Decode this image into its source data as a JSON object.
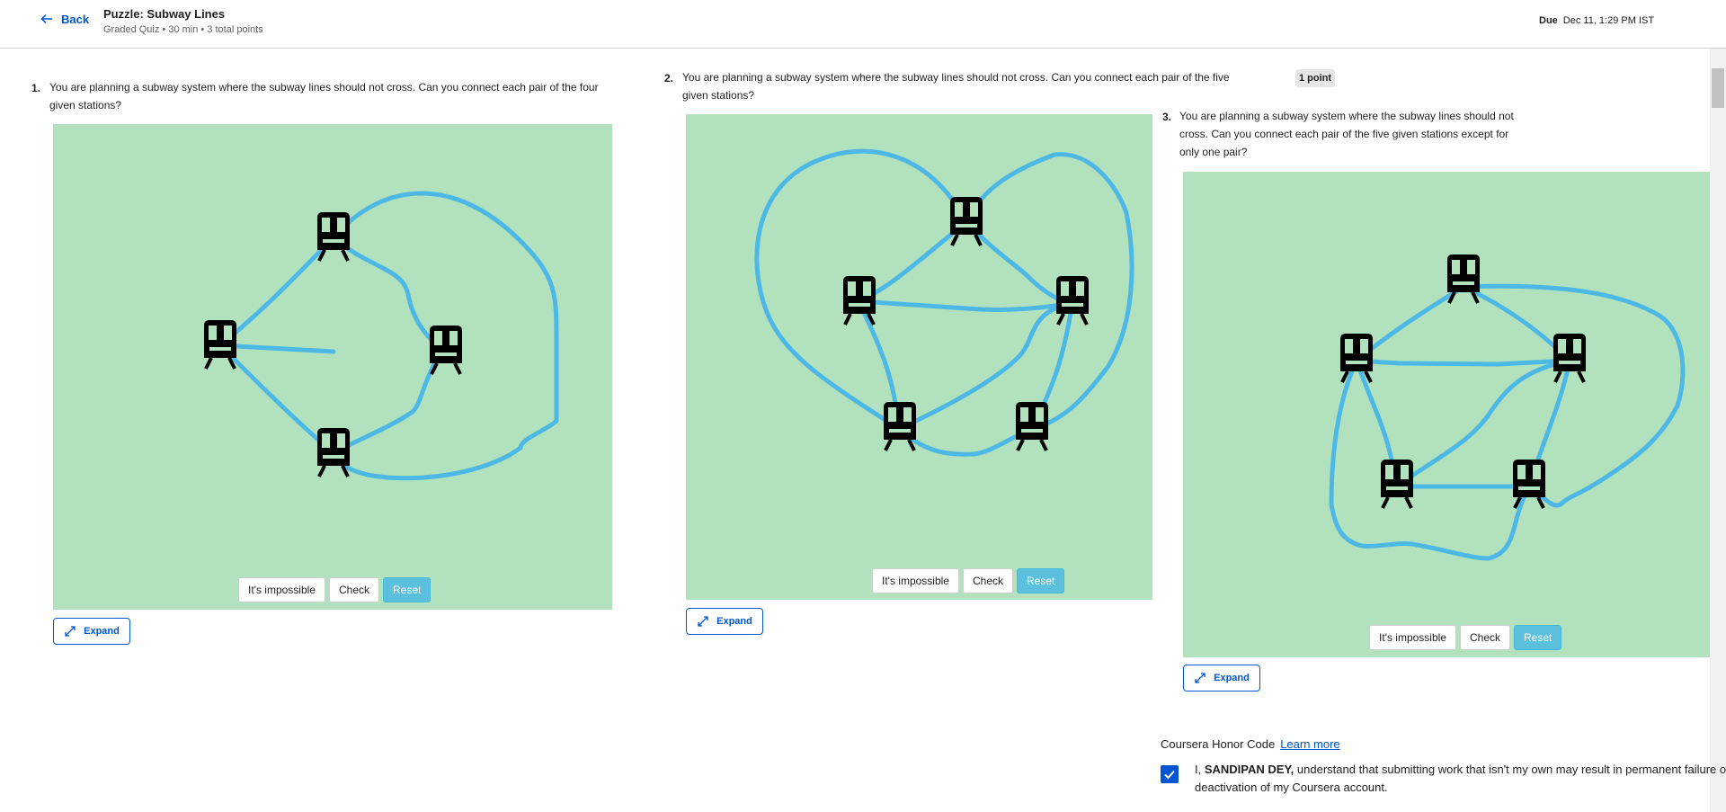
{
  "header": {
    "back_label": "Back",
    "title": "Puzzle: Subway Lines",
    "subtitle": "Graded Quiz • 30 min • 3 total points",
    "due_label": "Due",
    "due_value": "Dec 11, 1:29 PM IST"
  },
  "questions": [
    {
      "number": "1.",
      "text_line1": "You are planning a subway system where the subway lines should not cross. Can you connect each pair of the four",
      "text_line2": "given stations?",
      "btn_impossible": "It's impossible",
      "btn_check": "Check",
      "btn_reset": "Reset",
      "expand_label": "Expand"
    },
    {
      "number": "2.",
      "text_line1": "You are planning a subway system where the subway lines should not cross. Can you connect each pair of the five",
      "text_line2": "given stations?",
      "points": "1 point",
      "btn_impossible": "It's impossible",
      "btn_check": "Check",
      "btn_reset": "Reset",
      "expand_label": "Expand"
    },
    {
      "number": "3.",
      "text_line1": "You are planning a subway system where the subway lines should not",
      "text_line2": "cross. Can you connect each pair of the five given stations except for",
      "text_line3": "only one pair?",
      "btn_impossible": "It's impossible",
      "btn_check": "Check",
      "btn_reset": "Reset",
      "expand_label": "Expand"
    }
  ],
  "honor": {
    "title": "Coursera Honor Code",
    "learn_more": "Learn more",
    "prefix": "I, ",
    "name": "SANDIPAN DEY,",
    "statement_line1": " understand that submitting work that isn't my own may result in permanent failure of this",
    "statement_line2": "deactivation of my Coursera account.",
    "checked": true
  },
  "colors": {
    "accent": "#0056d2",
    "puzzle_bg": "#b2e2bd",
    "line": "#4db8e6",
    "reset": "#5bc0de"
  }
}
